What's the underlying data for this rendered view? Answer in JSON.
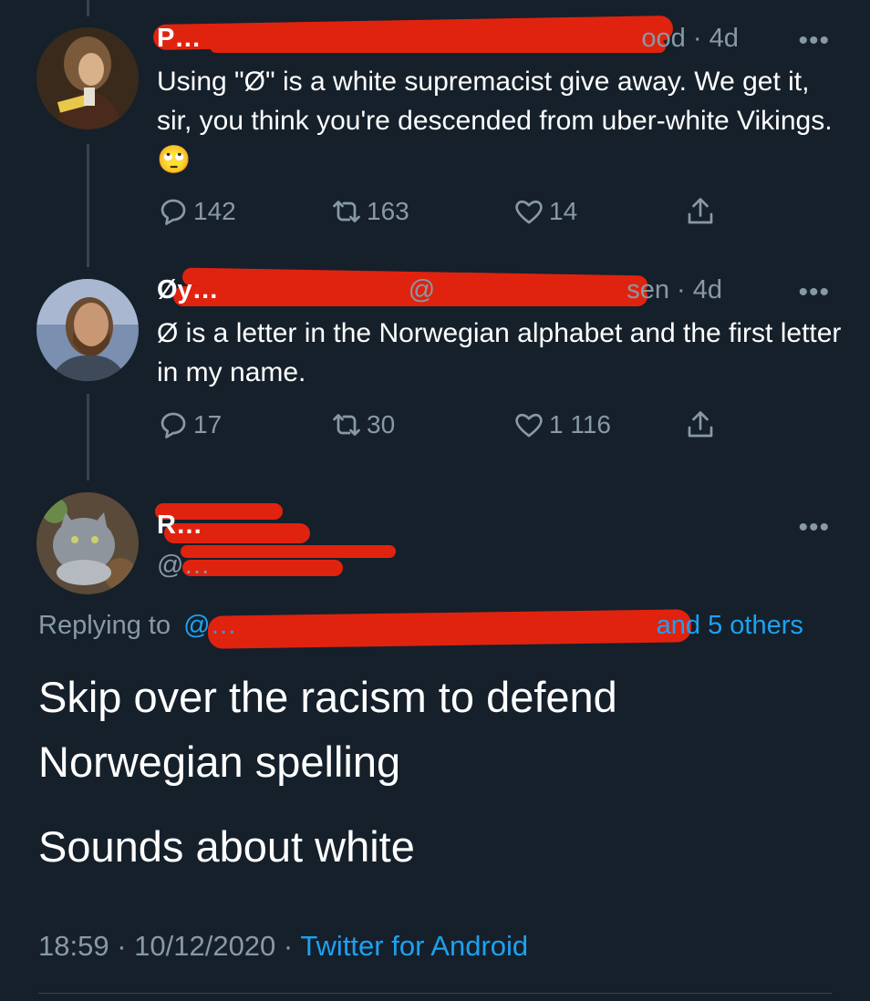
{
  "tweets": [
    {
      "name": "P…",
      "handle_suffix": "ood",
      "time": "· 4d",
      "text": "Using \"Ø\" is a white supremacist give away.  We get it, sir, you think you're descended from uber-white Vikings. 🙄",
      "replies": "142",
      "retweets": "163",
      "likes": "14"
    },
    {
      "name": "Øy…",
      "handle_prefix": "@",
      "handle_suffix": "sen",
      "time": "· 4d",
      "text": "Ø is a letter in the Norwegian alphabet and the first letter in my name.",
      "replies": "17",
      "retweets": "30",
      "likes": "1 116"
    }
  ],
  "main": {
    "name": "R…",
    "handle": "@…",
    "replying_label": "Replying to",
    "replying_handle": "@…",
    "replying_others": "and 5 others",
    "text_line1": "Skip over the racism to defend",
    "text_line2": "Norwegian spelling",
    "text_line3": "Sounds about white",
    "time": "18:59",
    "date": "10/12/2020",
    "source": "Twitter for Android"
  },
  "icons": {
    "reply": "reply-icon",
    "retweet": "retweet-icon",
    "like": "heart-icon",
    "share": "share-icon",
    "more": "more-icon"
  },
  "colors": {
    "background": "#15202b",
    "secondary_text": "#8899a6",
    "link": "#1da1f2",
    "redaction": "#e0230f"
  }
}
